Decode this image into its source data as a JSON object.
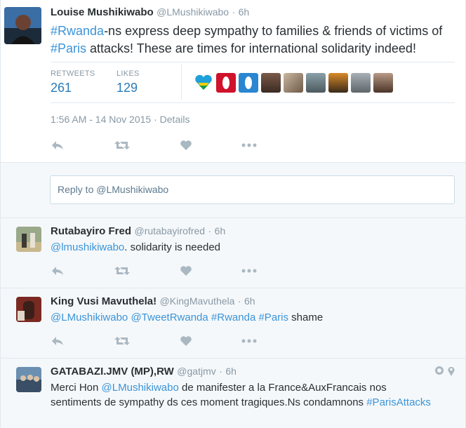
{
  "main_tweet": {
    "author_name": "Louise Mushikiwabo",
    "handle": "@LMushikiwabo",
    "time": "6h",
    "text_parts": [
      {
        "type": "hashtag",
        "text": "#Rwanda"
      },
      {
        "type": "text",
        "text": "-ns express deep sympathy to families & friends of victims of "
      },
      {
        "type": "hashtag",
        "text": "#Paris"
      },
      {
        "type": "text",
        "text": " attacks! These are times for international solidarity indeed!"
      }
    ],
    "retweets_label": "RETWEETS",
    "retweets_count": "261",
    "likes_label": "LIKES",
    "likes_count": "129",
    "timestamp": "1:56 AM - 14 Nov 2015",
    "details_link": "Details"
  },
  "reply_box": {
    "placeholder": "Reply to @LMushikiwabo"
  },
  "replies": [
    {
      "author_name": "Rutabayiro Fred",
      "handle": "@rutabayirofred",
      "time": "6h",
      "text_parts": [
        {
          "type": "mention",
          "text": "@lmushikiwabo"
        },
        {
          "type": "text",
          "text": ". solidarity is needed"
        }
      ]
    },
    {
      "author_name": "King Vusi Mavuthela!",
      "handle": "@KingMavuthela",
      "time": "6h",
      "text_parts": [
        {
          "type": "mention",
          "text": "@LMushikiwabo"
        },
        {
          "type": "text",
          "text": " "
        },
        {
          "type": "mention",
          "text": "@TweetRwanda"
        },
        {
          "type": "text",
          "text": " "
        },
        {
          "type": "hashtag",
          "text": "#Rwanda"
        },
        {
          "type": "text",
          "text": " "
        },
        {
          "type": "hashtag",
          "text": "#Paris"
        },
        {
          "type": "text",
          "text": " shame"
        }
      ]
    },
    {
      "author_name": "GATABAZI.JMV (MP),RW",
      "handle": "@gatjmv",
      "time": "6h",
      "text_parts": [
        {
          "type": "text",
          "text": "Merci Hon "
        },
        {
          "type": "mention",
          "text": "@LMushikiwabo"
        },
        {
          "type": "text",
          "text": " de manifester a la France&AuxFrancais nos sentiments de sympathy ds ces moment tragiques.Ns condamnons "
        },
        {
          "type": "hashtag",
          "text": "#ParisAttacks"
        }
      ]
    }
  ],
  "colors": {
    "link": "#3b94d9",
    "count": "#2b7bb9",
    "muted": "#8899a6",
    "icon": "#aab8c2"
  }
}
